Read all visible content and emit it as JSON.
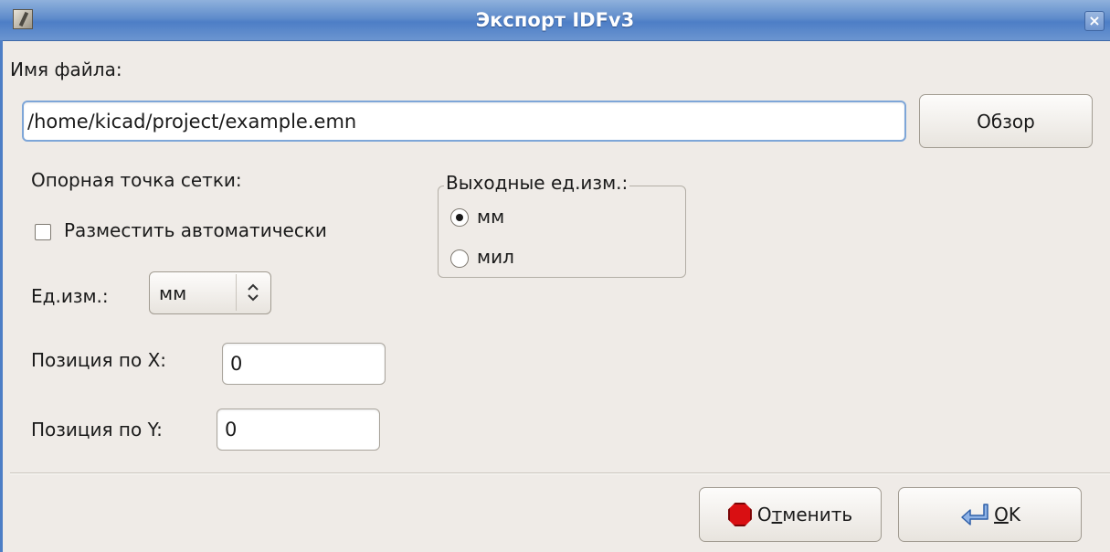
{
  "window": {
    "title": "Экспорт IDFv3",
    "close_glyph": "×"
  },
  "file": {
    "label": "Имя файла:",
    "value": "/home/kicad/project/example.emn",
    "browse_label": "Обзор"
  },
  "grid_origin": {
    "label": "Опорная точка сетки:",
    "auto_place_label": "Разместить автоматически",
    "auto_place_checked": false,
    "units_label": "Ед.изм.:",
    "units_value": "мм",
    "x_label": "Позиция по X:",
    "x_value": "0",
    "y_label": "Позиция по Y:",
    "y_value": "0"
  },
  "output_units": {
    "label": "Выходные ед.изм.:",
    "options": [
      {
        "label": "мм",
        "selected": true
      },
      {
        "label": "мил",
        "selected": false
      }
    ]
  },
  "buttons": {
    "cancel_prefix": "О",
    "cancel_mnemonic": "т",
    "cancel_rest": "менить",
    "ok_mnemonic": "O",
    "ok_rest": "K"
  },
  "icons": {
    "app": "dialog-app-icon",
    "close": "close-icon",
    "cancel": "stop-icon",
    "ok": "return-arrow-icon",
    "spinner": "up-down-chevrons-icon"
  }
}
